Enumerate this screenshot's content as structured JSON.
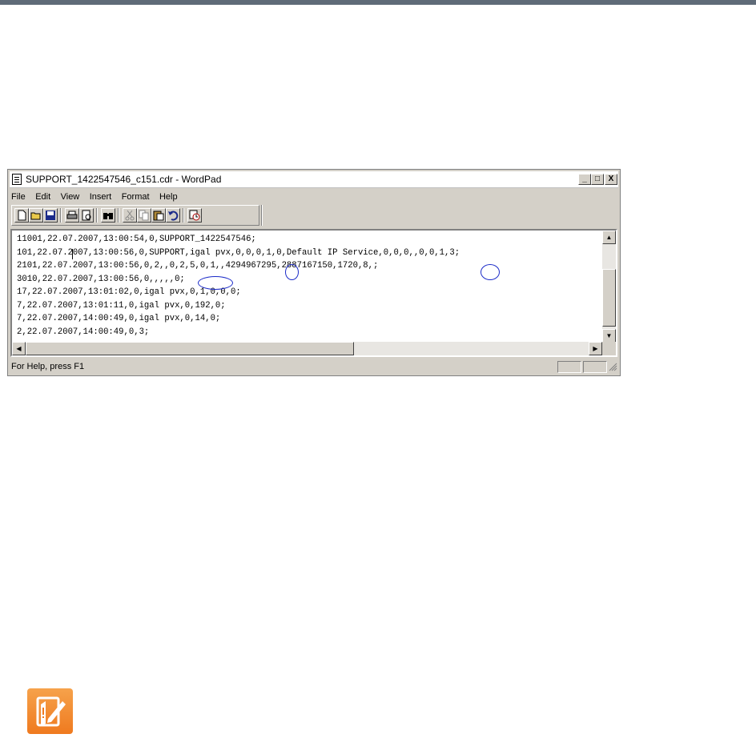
{
  "window": {
    "title": "SUPPORT_1422547546_c151.cdr - WordPad",
    "caption_buttons": {
      "minimize": "_",
      "maximize": "□",
      "close": "X"
    }
  },
  "menu": [
    "File",
    "Edit",
    "View",
    "Insert",
    "Format",
    "Help"
  ],
  "toolbar": {
    "buttons": [
      "new-icon",
      "open-icon",
      "save-icon",
      "print-icon",
      "print-preview-icon",
      "find-icon",
      "cut-icon",
      "copy-icon",
      "paste-icon",
      "undo-icon",
      "date-time-icon"
    ]
  },
  "document": {
    "lines": [
      "11001,22.07.2007,13:00:54,0,SUPPORT_1422547546;",
      "101,22.07.2007,13:00:56,0,SUPPORT,igal pvx,0,0,0,1,0,Default IP Service,0,0,0,,0,0,1,3;",
      "2101,22.07.2007,13:00:56,0,2,,0,2,5,0,1,,4294967295,2887167150,1720,8,;",
      "3010,22.07.2007,13:00:56,0,,,,,0;",
      "17,22.07.2007,13:01:02,0,igal pvx,0,1,0,0,0;",
      "7,22.07.2007,13:01:11,0,igal pvx,0,192,0;",
      "7,22.07.2007,14:00:49,0,igal pvx,0,14,0;",
      "2,22.07.2007,14:00:49,0,3;"
    ]
  },
  "status": {
    "help_text": "For Help, press F1"
  },
  "colors": {
    "annotation": "#1a2ac8",
    "note_icon": "#ef7a1f",
    "top_rule": "#5f6b78"
  }
}
